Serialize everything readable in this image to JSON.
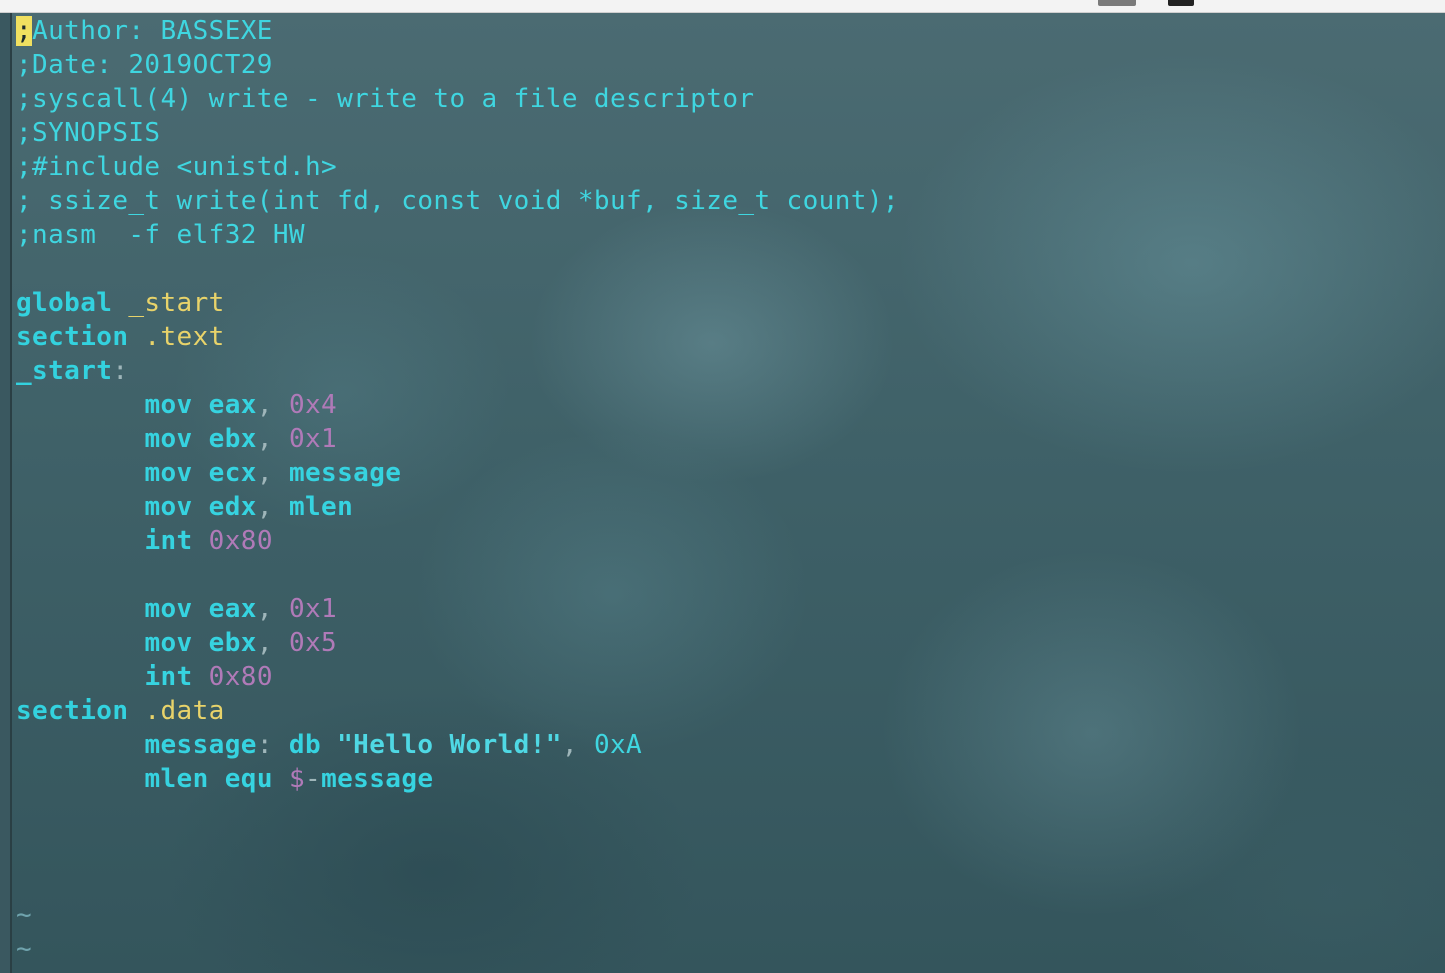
{
  "terminal": {
    "lines": [
      {
        "type": "comment",
        "text": "Author: BASSEXE",
        "cursor_char": ";"
      },
      {
        "type": "comment",
        "text": ";Date: 2019OCT29"
      },
      {
        "type": "comment",
        "text": ";syscall(4) write - write to a file descriptor"
      },
      {
        "type": "comment",
        "text": ";SYNOPSIS"
      },
      {
        "type": "comment",
        "text": ";#include <unistd.h>"
      },
      {
        "type": "comment",
        "text": "; ssize_t write(int fd, const void *buf, size_t count);"
      },
      {
        "type": "comment",
        "text": ";nasm  -f elf32 HW"
      },
      {
        "type": "blank"
      },
      {
        "type": "directive",
        "keyword": "global",
        "arg": " _start"
      },
      {
        "type": "directive",
        "keyword": "section",
        "arg": " .text"
      },
      {
        "type": "label",
        "name": "_start",
        "colon": ":"
      },
      {
        "type": "instr",
        "op": "mov",
        "reg": "eax",
        "comma": ", ",
        "val": "0x4",
        "valtype": "num"
      },
      {
        "type": "instr",
        "op": "mov",
        "reg": "ebx",
        "comma": ", ",
        "val": "0x1",
        "valtype": "num"
      },
      {
        "type": "instr",
        "op": "mov",
        "reg": "ecx",
        "comma": ", ",
        "val": "message",
        "valtype": "ident"
      },
      {
        "type": "instr",
        "op": "mov",
        "reg": "edx",
        "comma": ", ",
        "val": "mlen",
        "valtype": "ident"
      },
      {
        "type": "instr2",
        "op": "int",
        "val": "0x80"
      },
      {
        "type": "blank"
      },
      {
        "type": "instr",
        "op": "mov",
        "reg": "eax",
        "comma": ", ",
        "val": "0x1",
        "valtype": "num"
      },
      {
        "type": "instr",
        "op": "mov",
        "reg": "ebx",
        "comma": ", ",
        "val": "0x5",
        "valtype": "num"
      },
      {
        "type": "instr2",
        "op": "int",
        "val": "0x80"
      },
      {
        "type": "directive",
        "keyword": "section",
        "arg": " .data"
      },
      {
        "type": "data",
        "name": "message",
        "colon": ":",
        "op": " db ",
        "str": "\"Hello World!\"",
        "comma": ", ",
        "val": "0xA"
      },
      {
        "type": "equ",
        "name": "mlen",
        "op": " equ ",
        "dollar": "$",
        "dash": "-",
        "ref": "message"
      },
      {
        "type": "blank"
      },
      {
        "type": "blank"
      },
      {
        "type": "blank"
      },
      {
        "type": "tilde",
        "text": "~"
      },
      {
        "type": "tilde",
        "text": "~"
      },
      {
        "type": "tilde",
        "text": "~"
      }
    ]
  },
  "colors": {
    "comment": "#3fd6e0",
    "keyword": "#33d2df",
    "section_name": "#e8d36a",
    "number": "#b07ab8",
    "cursor": "#f0e060"
  }
}
